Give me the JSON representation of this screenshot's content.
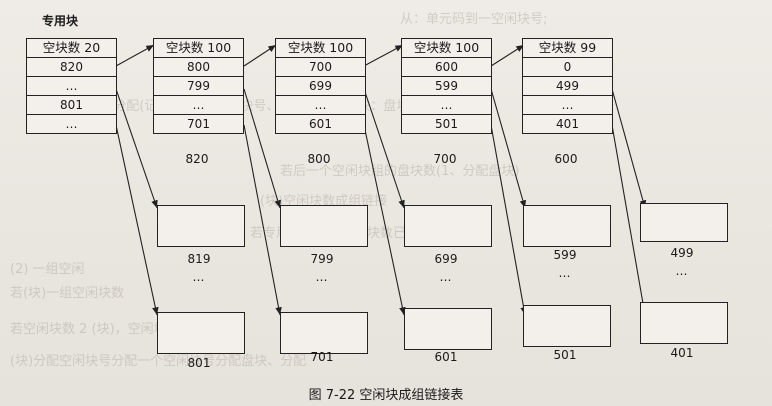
{
  "special_block_label": "专用块",
  "special_block": {
    "header": "空块数 20",
    "rows": [
      "820",
      "…",
      "801",
      "…"
    ]
  },
  "groups": [
    {
      "header": "空块数 100",
      "rows": [
        "800",
        "799",
        "…",
        "701"
      ],
      "below": "820",
      "box_top_label": "819",
      "box_dots": "…",
      "box_bottom_label": "801"
    },
    {
      "header": "空块数 100",
      "rows": [
        "700",
        "699",
        "…",
        "601"
      ],
      "below": "800",
      "box_top_label": "799",
      "box_dots": "…",
      "box_bottom_label": "701"
    },
    {
      "header": "空块数 100",
      "rows": [
        "600",
        "599",
        "…",
        "501"
      ],
      "below": "700",
      "box_top_label": "699",
      "box_dots": "…",
      "box_bottom_label": "601"
    },
    {
      "header": "空块数 99",
      "rows": [
        "0",
        "499",
        "…",
        "401"
      ],
      "below": "600",
      "box_top_label": "599",
      "box_dots": "…",
      "box_bottom_label": "501"
    }
  ],
  "last_box": {
    "top_label": "499",
    "dots": "…",
    "bottom_label": "401"
  },
  "caption": "图 7-22   空闲块成组链接表"
}
